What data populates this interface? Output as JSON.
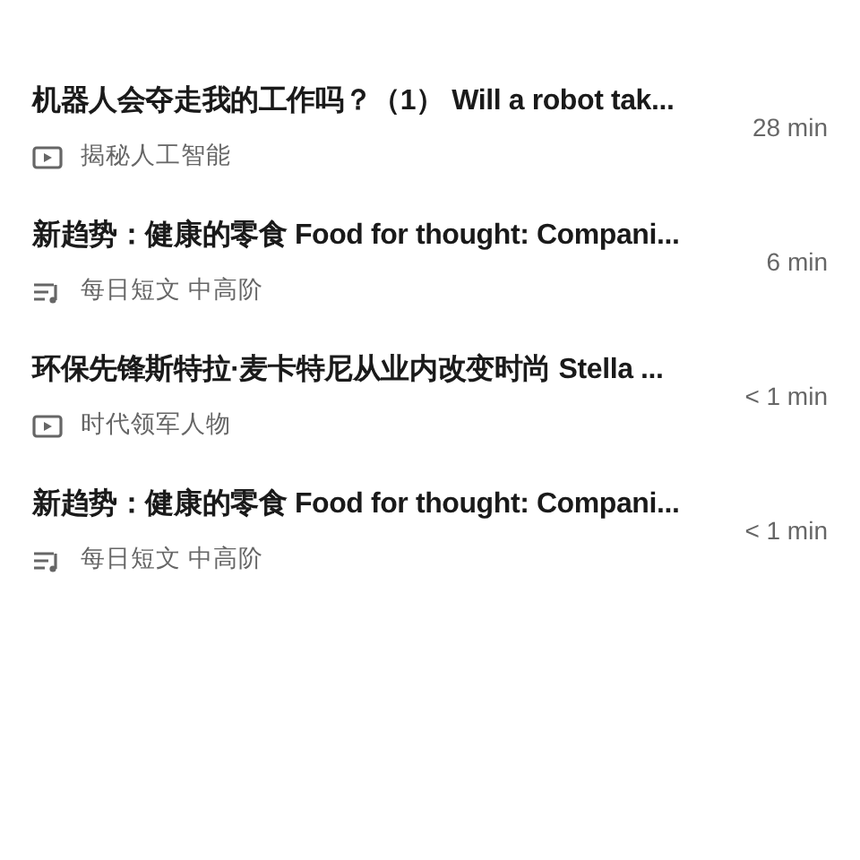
{
  "lessons": [
    {
      "title": "机器人会夺走我的工作吗？（1） Will a robot tak...",
      "kind": "video",
      "course": "揭秘人工智能",
      "duration": "28 min"
    },
    {
      "title": "新趋势：健康的零食 Food for thought: Compani...",
      "kind": "article",
      "course": "每日短文 中高阶",
      "duration": "6 min"
    },
    {
      "title": "环保先锋斯特拉·麦卡特尼从业内改变时尚 Stella ...",
      "kind": "video",
      "course": "时代领军人物",
      "duration": "< 1 min"
    },
    {
      "title": "新趋势：健康的零食 Food for thought: Compani...",
      "kind": "article",
      "course": "每日短文 中高阶",
      "duration": "< 1 min"
    }
  ]
}
